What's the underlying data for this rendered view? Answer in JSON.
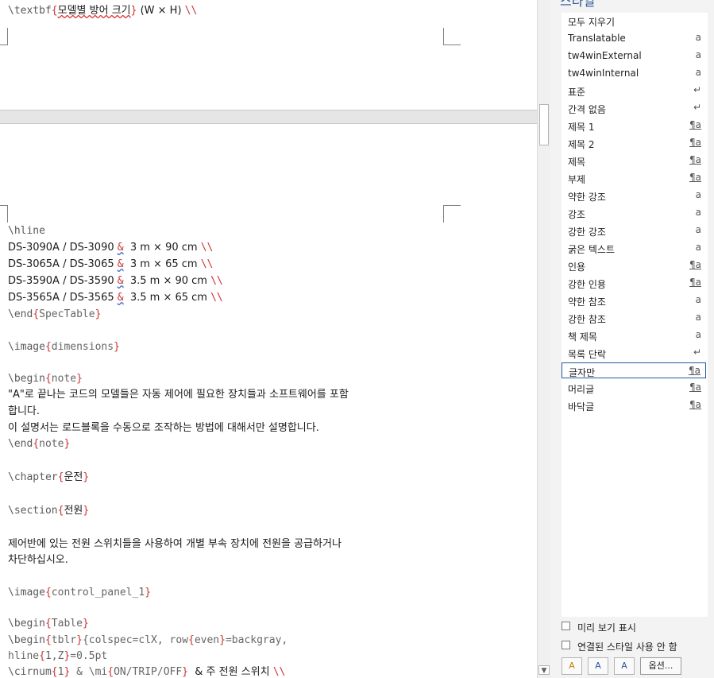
{
  "document": {
    "top_line": {
      "cmd": "\\textbf",
      "text": "모델별 방어 크기",
      "tail": " (W × H) ",
      "end": "\\\\"
    },
    "lines": [
      {
        "a": "\\hline"
      },
      {
        "a": "DS-3090A / DS-3090 ",
        "amp": "&",
        "b": "  3 m × 90 cm ",
        "end": "\\\\"
      },
      {
        "a": "DS-3065A / DS-3065 ",
        "amp": "&",
        "b": "  3 m × 65 cm ",
        "end": "\\\\"
      },
      {
        "a": "DS-3590A / DS-3590 ",
        "amp": "&",
        "b": "  3.5 m × 90 cm ",
        "end": "\\\\"
      },
      {
        "a": "DS-3565A / DS-3565 ",
        "amp": "&",
        "b": "  3.5 m × 65 cm ",
        "end": "\\\\"
      },
      {
        "cmd": "\\end",
        "arg": "SpecTable"
      },
      {
        "cmd": "\\image",
        "arg": "dimensions"
      },
      {
        "cmd": "\\begin",
        "arg": "note"
      },
      {
        "text": "\"A\"로 끝나는 코드의 모델들은 자동 제어에 필요한 장치들과 소프트웨어를 포함"
      },
      {
        "text": "합니다."
      },
      {
        "text": "이 설명서는 로드블록을 수동으로 조작하는 방법에 대해서만 설명합니다."
      },
      {
        "cmd": "\\end",
        "arg": "note"
      },
      {
        "cmd": "\\chapter",
        "arg": "운전"
      },
      {
        "cmd": "\\section",
        "arg": "전원"
      },
      {
        "text": "제어반에 있는 전원 스위치들을 사용하여 개별 부속 장치에 전원을 공급하거나"
      },
      {
        "text": "차단하십시오."
      },
      {
        "cmd": "\\image",
        "arg": "control_panel_1"
      },
      {
        "cmd": "\\begin",
        "arg": "Table"
      },
      {
        "cmd": "\\begin",
        "arg": "tblr",
        "rest1": "{colspec=clX, row",
        "rest2": "even",
        "rest3": "=backgray,"
      },
      {
        "a": "hline",
        "b": "1,Z",
        "c": "=0.5pt"
      },
      {
        "cmd": "\\cirnum",
        "arg": "1",
        "mid": " & \\mi",
        "arg2": "ON/TRIP/OFF",
        "tail": "  & 주 전원 스위치 ",
        "end": "\\\\"
      }
    ]
  },
  "styles_pane": {
    "title": "스타일",
    "items": [
      {
        "name": "모두 지우기",
        "icon": ""
      },
      {
        "name": "Translatable",
        "icon": "a"
      },
      {
        "name": "tw4winExternal",
        "icon": "a"
      },
      {
        "name": "tw4winInternal",
        "icon": "a"
      },
      {
        "name": "표준",
        "icon": "↵"
      },
      {
        "name": "간격 없음",
        "icon": "↵"
      },
      {
        "name": "제목 1",
        "icon": "¶a"
      },
      {
        "name": "제목 2",
        "icon": "¶a"
      },
      {
        "name": "제목",
        "icon": "¶a"
      },
      {
        "name": "부제",
        "icon": "¶a"
      },
      {
        "name": "약한 강조",
        "icon": "a"
      },
      {
        "name": "강조",
        "icon": "a"
      },
      {
        "name": "강한 강조",
        "icon": "a"
      },
      {
        "name": "굵은 텍스트",
        "icon": "a"
      },
      {
        "name": "인용",
        "icon": "¶a"
      },
      {
        "name": "강한 인용",
        "icon": "¶a"
      },
      {
        "name": "약한 참조",
        "icon": "a"
      },
      {
        "name": "강한 참조",
        "icon": "a"
      },
      {
        "name": "책 제목",
        "icon": "a"
      },
      {
        "name": "목록 단락",
        "icon": "↵"
      },
      {
        "name": "글자만",
        "icon": "¶a",
        "selected": true
      },
      {
        "name": "머리글",
        "icon": "¶a"
      },
      {
        "name": "바닥글",
        "icon": "¶a"
      }
    ],
    "show_preview": "미리 보기 표시",
    "disable_linked": "연결된 스타일 사용 안 함",
    "options": "옵션..."
  }
}
